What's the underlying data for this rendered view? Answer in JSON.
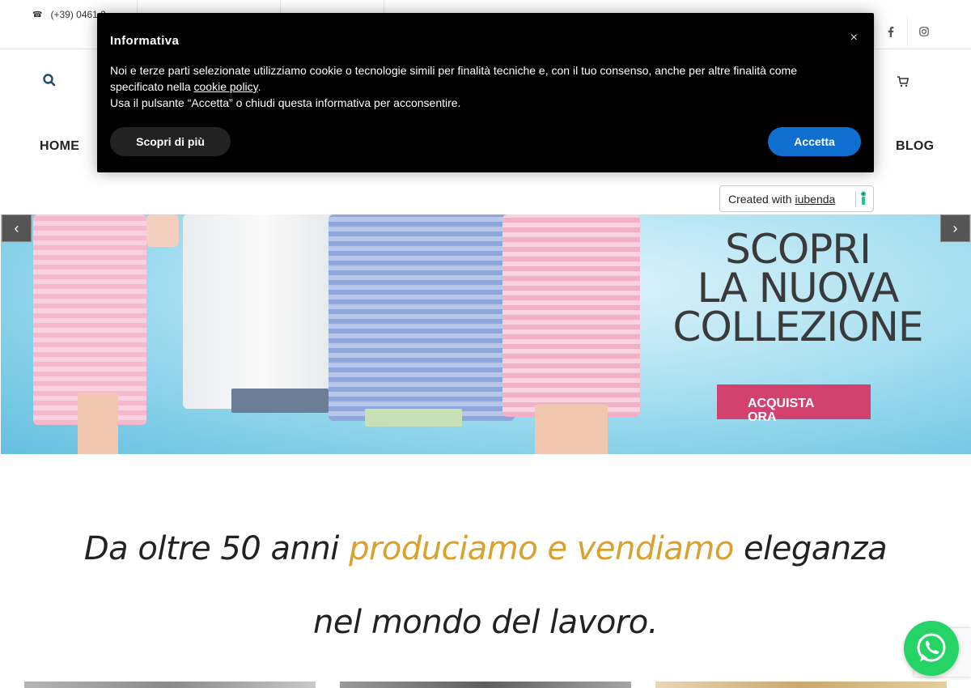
{
  "topbar": {
    "phone": "(+39) 0461 2",
    "social": [
      "facebook-icon",
      "instagram-icon"
    ]
  },
  "nav": {
    "home": "HOME",
    "blog": "BLOG"
  },
  "hero": {
    "title_lines": [
      "SCOPRI",
      "LA NUOVA",
      "COLLEZIONE"
    ],
    "cta_lines": [
      "ACQUISTA",
      "ORA"
    ],
    "prev_icon": "chevron-left-icon",
    "next_icon": "chevron-right-icon"
  },
  "tagline": {
    "line1_start": "Da oltre 50 anni ",
    "line1_accent": "produciamo e vendiamo",
    "line1_end": " eleganza",
    "line2": "nel mondo del lavoro."
  },
  "cookie_banner": {
    "title": "Informativa",
    "close": "×",
    "text_part1": "Noi e terze parti selezionate utilizziamo cookie o tecnologie simili per finalità tecniche e, con il tuo consenso, anche per altre finalità come specificato nella ",
    "link": "cookie policy",
    "text_part2": ".",
    "text_line2": "Usa il pulsante “Accetta” o chiudi questa informativa per acconsentire.",
    "learn_more": "Scopri di più",
    "accept": "Accetta"
  },
  "iubenda_badge": {
    "prefix": "Created with ",
    "brand": "iubenda"
  },
  "colors": {
    "accent_gold": "#d9a12e",
    "cta_pink": "#d2416f",
    "accept_blue": "#0f6fd1",
    "whatsapp_green": "#25d366"
  }
}
